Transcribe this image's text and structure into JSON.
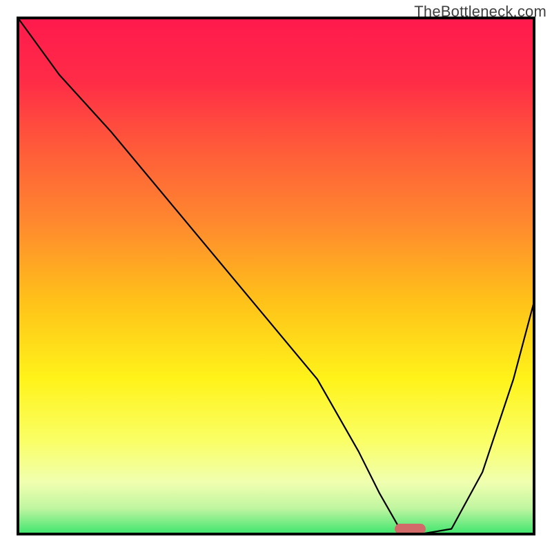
{
  "watermark": "TheBottleneck.com",
  "chart_data": {
    "type": "line",
    "title": "",
    "xlabel": "",
    "ylabel": "",
    "xlim": [
      0,
      100
    ],
    "ylim": [
      0,
      100
    ],
    "background_gradient": {
      "stops": [
        {
          "offset": 0.0,
          "color": "#ff1a4d"
        },
        {
          "offset": 0.12,
          "color": "#ff2b47"
        },
        {
          "offset": 0.25,
          "color": "#ff5a3a"
        },
        {
          "offset": 0.4,
          "color": "#ff8a2e"
        },
        {
          "offset": 0.55,
          "color": "#ffc219"
        },
        {
          "offset": 0.7,
          "color": "#fff31a"
        },
        {
          "offset": 0.82,
          "color": "#faff66"
        },
        {
          "offset": 0.9,
          "color": "#f0ffb0"
        },
        {
          "offset": 0.95,
          "color": "#c0f5a0"
        },
        {
          "offset": 1.0,
          "color": "#3de56e"
        }
      ]
    },
    "series": [
      {
        "name": "bottleneck-curve",
        "x": [
          0,
          8,
          18,
          28,
          38,
          48,
          58,
          66,
          70,
          74,
          78,
          84,
          90,
          96,
          100
        ],
        "y": [
          100,
          89,
          78,
          66,
          54,
          42,
          30,
          16,
          8,
          1,
          0,
          1,
          12,
          30,
          45
        ]
      }
    ],
    "marker": {
      "name": "optimal-point",
      "x": 76,
      "y": 0,
      "color": "#d36a6a",
      "width": 6,
      "height": 2
    },
    "frame_color": "#000000"
  }
}
